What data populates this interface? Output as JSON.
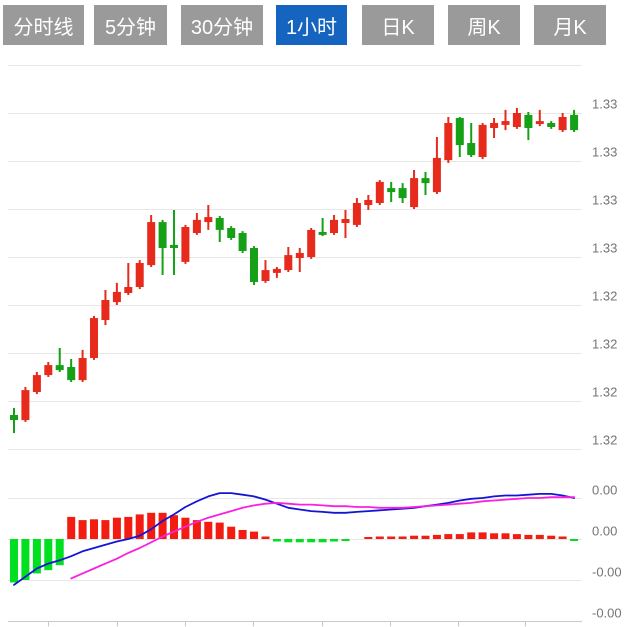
{
  "tabbar": {
    "items": [
      {
        "name": "tab-time-share",
        "label": "分时线",
        "active": false
      },
      {
        "name": "tab-5min",
        "label": "5分钟",
        "active": false
      },
      {
        "name": "tab-30min",
        "label": "30分钟",
        "active": false
      },
      {
        "name": "tab-1hour",
        "label": "1小时",
        "active": true
      },
      {
        "name": "tab-daily-k",
        "label": "日K",
        "active": false
      },
      {
        "name": "tab-weekly-k",
        "label": "周K",
        "active": false
      },
      {
        "name": "tab-monthly-k",
        "label": "月K",
        "active": false
      }
    ]
  },
  "colors": {
    "tab_inactive_bg": "#9a9a9a",
    "tab_active_bg": "#1565c0",
    "tab_text": "#ffffff",
    "candle_up_red": "#e62a1b",
    "candle_down_green": "#16a016",
    "hist_red": "#f31c10",
    "hist_green": "#00df20",
    "dif_line_blue": "#1414d6",
    "dea_line_magenta": "#fb20dd",
    "gridline": "#e7e7e7",
    "axis_line": "#c9c9c9",
    "label_text": "#757575",
    "background": "#ffffff"
  },
  "chart_data": {
    "type": "candlestick",
    "timeframe_selected": "1小时",
    "legend_position": "none",
    "grid": true,
    "main_pane": {
      "y_axis_side": "right",
      "ylim": [
        1.315,
        1.335
      ],
      "grid_values": [
        1.335,
        1.3325,
        1.33,
        1.3275,
        1.325,
        1.3225,
        1.32,
        1.3175,
        1.315
      ],
      "grid_labels": [
        "",
        "1.33",
        "1.33",
        "1.33",
        "1.33",
        "1.32",
        "1.32",
        "1.32",
        "1.32"
      ],
      "up_color_rule": "close >= open is red (CN convention), close < open is green",
      "ohlc_order": [
        "open",
        "high",
        "low",
        "close"
      ],
      "candles_ohlc": [
        [
          1.31677,
          1.31714,
          1.31583,
          1.31651
        ],
        [
          1.31651,
          1.31823,
          1.31641,
          1.31807
        ],
        [
          1.31797,
          1.31901,
          1.31786,
          1.31885
        ],
        [
          1.31885,
          1.31953,
          1.31875,
          1.31937
        ],
        [
          1.31937,
          1.32026,
          1.31901,
          1.31911
        ],
        [
          1.31927,
          1.31969,
          1.31849,
          1.31859
        ],
        [
          1.31859,
          1.32016,
          1.31849,
          1.31974
        ],
        [
          1.31974,
          1.32193,
          1.31964,
          1.32182
        ],
        [
          1.32172,
          1.32328,
          1.32146,
          1.32276
        ],
        [
          1.32265,
          1.32365,
          1.3225,
          1.32318
        ],
        [
          1.32313,
          1.32469,
          1.32302,
          1.32344
        ],
        [
          1.32344,
          1.32484,
          1.32333,
          1.32469
        ],
        [
          1.32458,
          1.32719,
          1.32448,
          1.32682
        ],
        [
          1.32682,
          1.32693,
          1.32406,
          1.32547
        ],
        [
          1.32563,
          1.32745,
          1.32406,
          1.32547
        ],
        [
          1.32474,
          1.32667,
          1.32464,
          1.32656
        ],
        [
          1.32625,
          1.32729,
          1.32615,
          1.32693
        ],
        [
          1.32682,
          1.32771,
          1.32641,
          1.32708
        ],
        [
          1.32703,
          1.32714,
          1.32578,
          1.32641
        ],
        [
          1.32651,
          1.32661,
          1.32589,
          1.32599
        ],
        [
          1.32625,
          1.32635,
          1.32521,
          1.32531
        ],
        [
          1.32547,
          1.32557,
          1.32354,
          1.3237
        ],
        [
          1.32375,
          1.32484,
          1.32365,
          1.32432
        ],
        [
          1.32417,
          1.32448,
          1.32391,
          1.32438
        ],
        [
          1.32432,
          1.32552,
          1.32422,
          1.3251
        ],
        [
          1.32495,
          1.32547,
          1.32422,
          1.32521
        ],
        [
          1.325,
          1.32651,
          1.3249,
          1.32641
        ],
        [
          1.3263,
          1.32703,
          1.32609,
          1.32615
        ],
        [
          1.32625,
          1.32719,
          1.32615,
          1.32693
        ],
        [
          1.32677,
          1.32745,
          1.32599,
          1.32698
        ],
        [
          1.32667,
          1.32807,
          1.32656,
          1.32781
        ],
        [
          1.32771,
          1.32823,
          1.32745,
          1.32797
        ],
        [
          1.32781,
          1.32901,
          1.32771,
          1.32891
        ],
        [
          1.32859,
          1.32891,
          1.32786,
          1.32838
        ],
        [
          1.32859,
          1.32885,
          1.32781,
          1.32807
        ],
        [
          1.3276,
          1.32953,
          1.3275,
          1.32911
        ],
        [
          1.32911,
          1.32943,
          1.32823,
          1.32885
        ],
        [
          1.32838,
          1.33125,
          1.32828,
          1.33016
        ],
        [
          1.33005,
          1.33229,
          1.3299,
          1.33198
        ],
        [
          1.33224,
          1.33229,
          1.33021,
          1.33083
        ],
        [
          1.33094,
          1.33198,
          1.33021,
          1.33031
        ],
        [
          1.33021,
          1.33198,
          1.3301,
          1.33188
        ],
        [
          1.33172,
          1.33224,
          1.3312,
          1.33198
        ],
        [
          1.33188,
          1.33266,
          1.33161,
          1.33208
        ],
        [
          1.33177,
          1.33276,
          1.33167,
          1.3325
        ],
        [
          1.3324,
          1.33255,
          1.33109,
          1.33172
        ],
        [
          1.33193,
          1.33266,
          1.33182,
          1.33208
        ],
        [
          1.33198,
          1.33208,
          1.33167,
          1.33177
        ],
        [
          1.33161,
          1.3325,
          1.33151,
          1.33229
        ],
        [
          1.3324,
          1.33266,
          1.33151,
          1.33161
        ]
      ]
    },
    "macd_pane": {
      "y_axis_side": "right",
      "ylim": [
        -0.001,
        0.0005
      ],
      "grid_values": [
        0.0005,
        0.0,
        -0.0005,
        -0.001
      ],
      "grid_labels": [
        "0.00",
        "0.00",
        "-0.00",
        "-0.00"
      ],
      "histogram": [
        -0.00053,
        -0.0005,
        -0.00042,
        -0.00038,
        -0.00032,
        0.00027,
        0.00023,
        0.00024,
        0.00023,
        0.00026,
        0.00027,
        0.0003,
        0.00032,
        0.00032,
        0.00029,
        0.00026,
        0.00023,
        0.00021,
        0.0002,
        0.00015,
        0.00011,
        9e-05,
        3e-05,
        -3e-05,
        -4e-05,
        -4e-05,
        -4e-05,
        -4e-05,
        -3e-05,
        -2e-05,
        0.0,
        2e-05,
        3e-05,
        3e-05,
        3e-05,
        4e-05,
        4e-05,
        5e-05,
        6e-05,
        6e-05,
        8e-05,
        8e-05,
        7e-05,
        7e-05,
        6e-05,
        5e-05,
        5e-05,
        4e-05,
        3e-05,
        -2e-05
      ],
      "dif": [
        -0.00056,
        -0.00046,
        -0.00036,
        -0.0003,
        -0.00026,
        -0.00021,
        -0.00015,
        -0.00011,
        -7e-05,
        -3e-05,
        0.0,
        4e-05,
        0.00012,
        0.00022,
        0.0003,
        0.00039,
        0.00046,
        0.00052,
        0.00056,
        0.00056,
        0.00054,
        0.00052,
        0.00048,
        0.00043,
        0.00038,
        0.00036,
        0.00034,
        0.00033,
        0.00032,
        0.00032,
        0.00033,
        0.00034,
        0.00035,
        0.00036,
        0.00037,
        0.00038,
        0.0004,
        0.00042,
        0.00044,
        0.00047,
        0.00049,
        0.0005,
        0.00052,
        0.00053,
        0.00053,
        0.00054,
        0.00055,
        0.00055,
        0.00053,
        0.0005
      ],
      "dea": [
        null,
        null,
        null,
        null,
        null,
        -0.00048,
        -0.00042,
        -0.00036,
        -0.0003,
        -0.00024,
        -0.00017,
        -0.00011,
        -4e-05,
        3e-05,
        9e-05,
        0.00015,
        0.00021,
        0.00026,
        0.0003,
        0.00034,
        0.00038,
        0.00041,
        0.00043,
        0.00044,
        0.00043,
        0.00042,
        0.00042,
        0.00041,
        0.0004,
        0.0004,
        0.00039,
        0.00039,
        0.00038,
        0.00038,
        0.00038,
        0.00039,
        0.0004,
        0.00041,
        0.00042,
        0.00043,
        0.00044,
        0.00046,
        0.00047,
        0.00048,
        0.00049,
        0.0005,
        0.0005,
        0.00051,
        0.00051,
        0.00051
      ]
    }
  }
}
